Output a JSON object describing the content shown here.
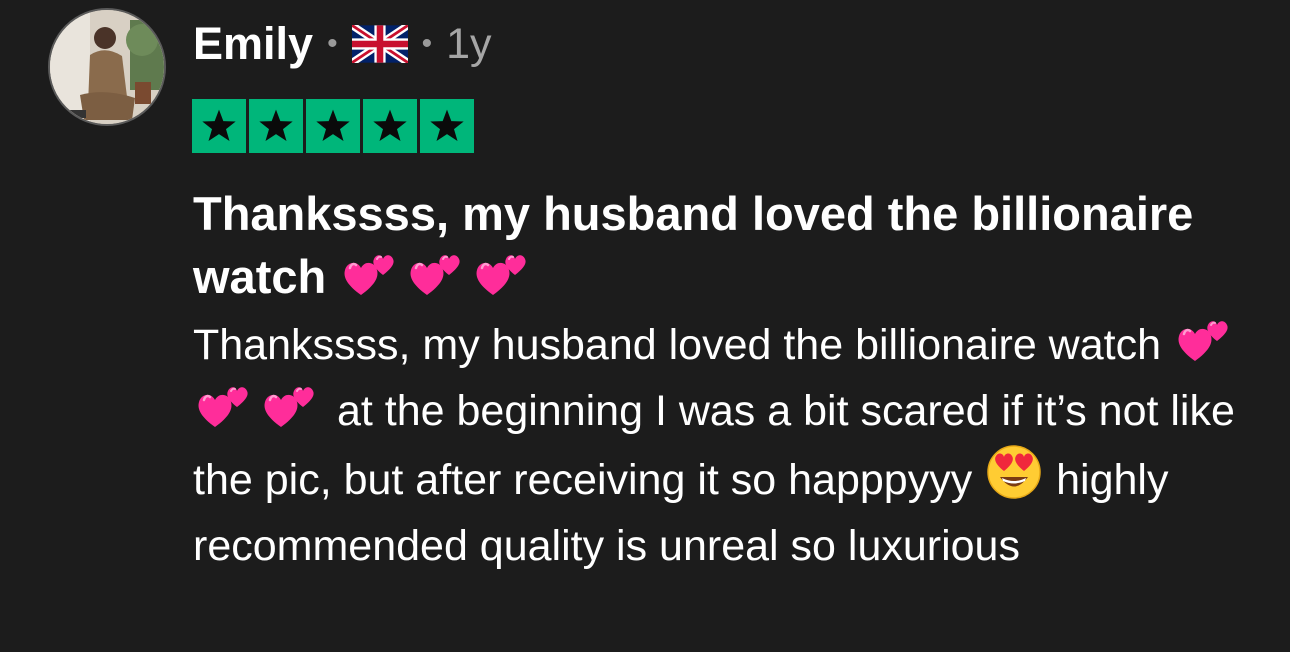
{
  "review": {
    "author": "Emily",
    "country_flag_icon": "uk-flag-icon",
    "separator": "•",
    "age": "1y",
    "rating": 5,
    "rating_max": 5,
    "star_color": "#00b67a",
    "title_text": "Thankssss, my husband loved the billionaire watch",
    "body": {
      "part1": "Thankssss, my husband loved the billionaire watch",
      "part2": "at the beginning I was a bit scared if it’s not like the pic, but after receiving it so happpyyy",
      "part3": "highly recommended quality is unreal so luxurious"
    },
    "emojis": {
      "hearts": "two-hearts-emoji",
      "heart_eyes": "heart-eyes-emoji"
    }
  },
  "colors": {
    "background": "#1c1c1c",
    "text": "#ffffff",
    "meta": "#a6a6a6"
  }
}
